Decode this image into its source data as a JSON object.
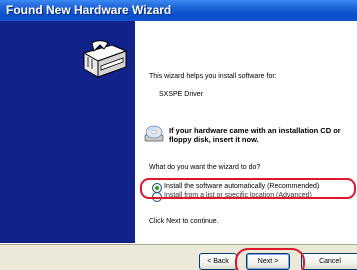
{
  "window": {
    "title": "Found New Hardware Wizard"
  },
  "content": {
    "intro": "This wizard helps you install software for:",
    "device_name": "SXSPE Driver",
    "cd_prompt": "If your hardware came with an installation CD or floppy disk, insert it now.",
    "question": "What do you want the wizard to do?",
    "options": [
      {
        "label": "Install the software automatically (Recommended)",
        "selected": true
      },
      {
        "label": "Install from a list or specific location (Advanced)",
        "selected": false
      }
    ],
    "continue_text": "Click Next to continue."
  },
  "buttons": {
    "back": "< Back",
    "next": "Next >",
    "cancel": "Cancel"
  },
  "colors": {
    "title_bar": "#0a4fcc",
    "left_panel": "#11228a",
    "highlight": "#e0162b"
  }
}
